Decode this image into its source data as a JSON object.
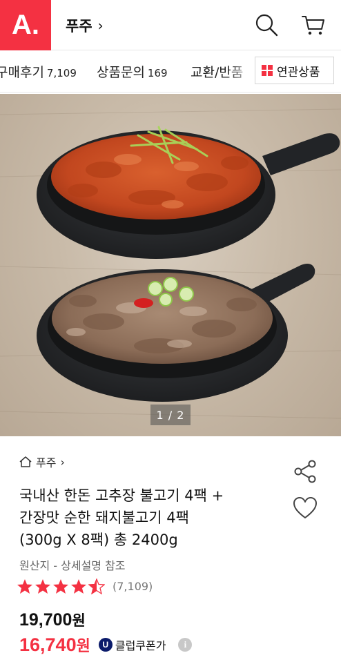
{
  "header": {
    "logo_text": "A.",
    "store_name": "푸주",
    "store_chevron": "›",
    "brand_color": "#f43142"
  },
  "tabs": {
    "items": [
      {
        "label": "구매후기",
        "count": "7,109"
      },
      {
        "label": "상품문의",
        "count": "169"
      },
      {
        "label": "교환/반품",
        "count": ""
      }
    ],
    "related_label": "연관상품"
  },
  "gallery": {
    "pager": "1 / 2"
  },
  "product": {
    "breadcrumb": "푸주",
    "breadcrumb_chevron": "›",
    "title_lines": [
      "국내산 한돈 고추장 불고기 4팩 +",
      "간장맛 순한 돼지불고기 4팩",
      "(300g X 8팩) 총 2400g"
    ],
    "origin": "원산지 - 상세설명 참조",
    "rating": {
      "value": 4.5,
      "max": 5,
      "count_text": "(7,109)"
    },
    "price": {
      "amount": "19,700",
      "unit": "원"
    },
    "sale_price": {
      "amount": "16,740",
      "unit": "원"
    },
    "coupon_label": "클럽쿠폰가",
    "coupon_badge_letter": "U",
    "info_icon_text": "i"
  }
}
